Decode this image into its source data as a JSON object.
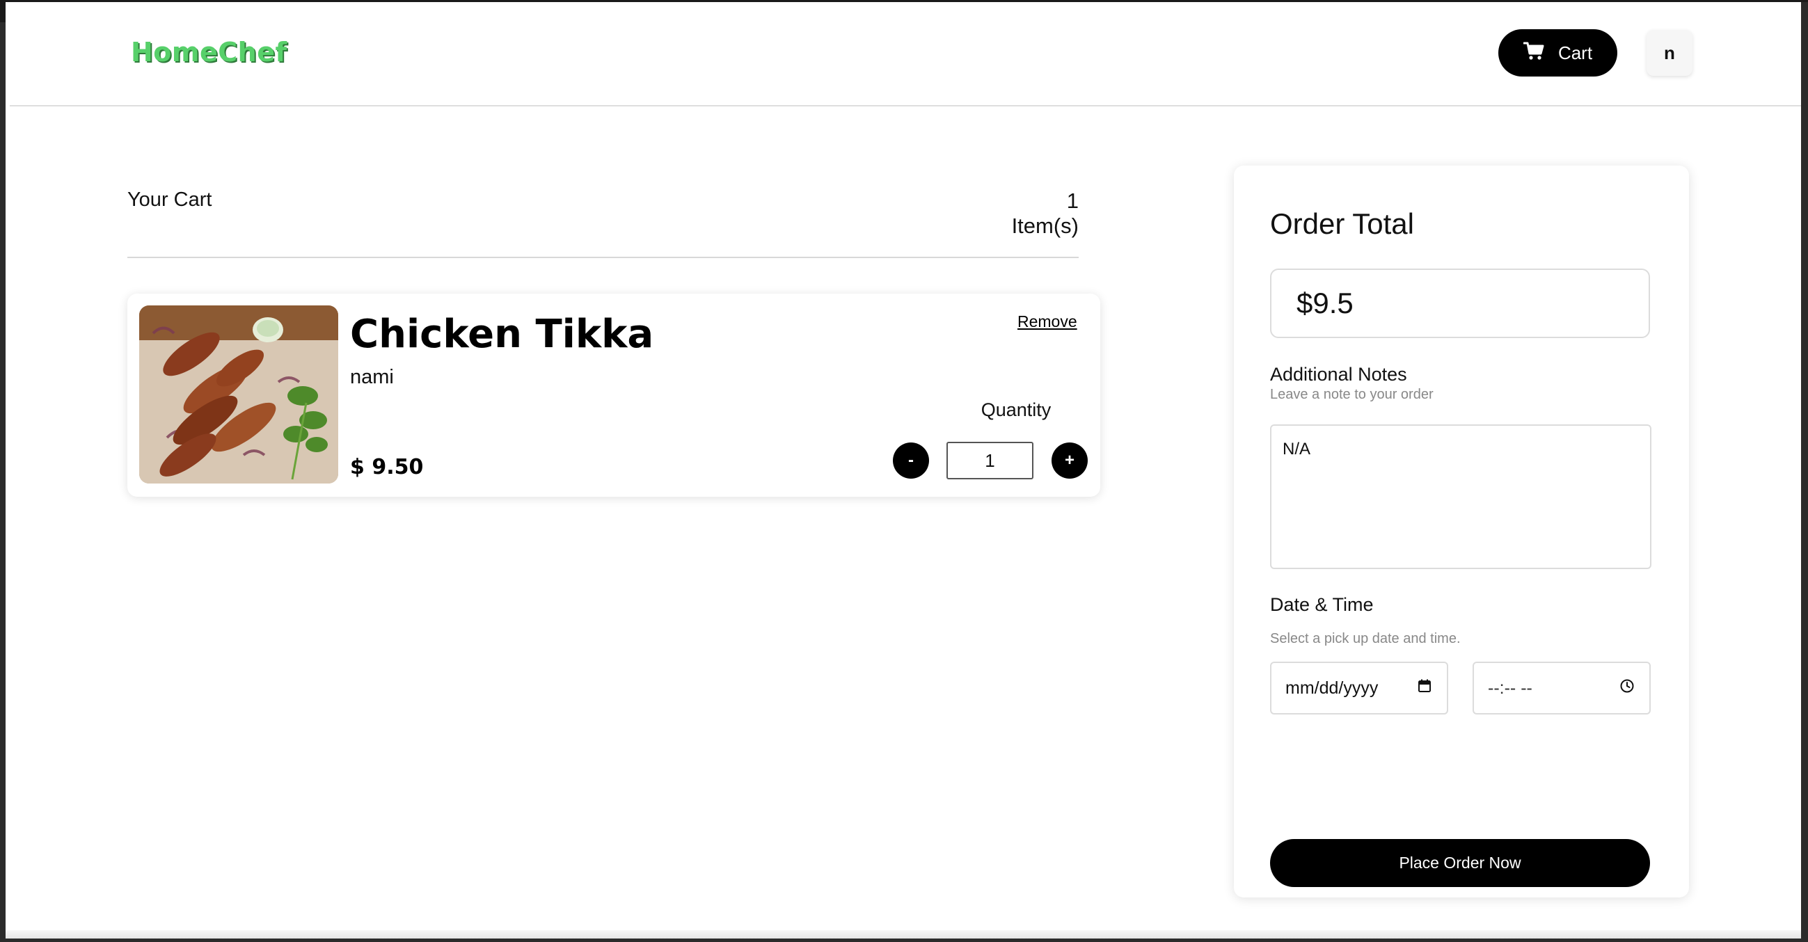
{
  "header": {
    "logo": "HomeChef",
    "cart_label": "Cart",
    "avatar_initial": "n"
  },
  "cart": {
    "title": "Your Cart",
    "count": "1 Item(s)",
    "items": [
      {
        "name": "Chicken Tikka",
        "chef": "nami",
        "price": "$ 9.50",
        "remove_label": "Remove",
        "quantity_label": "Quantity",
        "quantity": "1",
        "minus_label": "-",
        "plus_label": "+"
      }
    ]
  },
  "order": {
    "title": "Order Total",
    "total": "$9.5",
    "notes_label": "Additional Notes",
    "notes_sub": "Leave a note to your order",
    "notes_value": "N/A",
    "datetime_label": "Date & Time",
    "datetime_sub": "Select a pick up date and time.",
    "date_placeholder": "mm/dd/yyyy",
    "time_placeholder": "--:-- --",
    "place_order_label": "Place Order Now"
  },
  "colors": {
    "brand": "#57d06a",
    "primary": "#000000"
  },
  "icons": {
    "cart": "cart-icon",
    "calendar": "calendar-icon",
    "clock": "clock-icon"
  }
}
